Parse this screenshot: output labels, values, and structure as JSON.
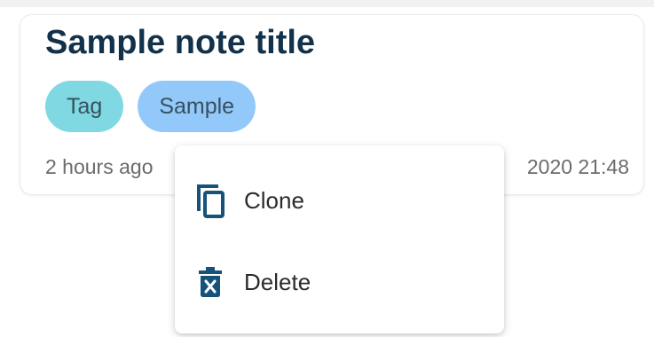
{
  "note": {
    "title": "Sample note title",
    "tags": [
      "Tag",
      "Sample"
    ],
    "meta_left": "2 hours ago",
    "meta_right": "2020 21:48"
  },
  "context_menu": {
    "items": [
      {
        "label": "Clone",
        "icon": "copy-icon"
      },
      {
        "label": "Delete",
        "icon": "trash-icon"
      }
    ]
  },
  "colors": {
    "title": "#12314a",
    "tag_teal": "#7fd8e2",
    "tag_blue": "#93c8fa",
    "icon": "#16527a"
  }
}
